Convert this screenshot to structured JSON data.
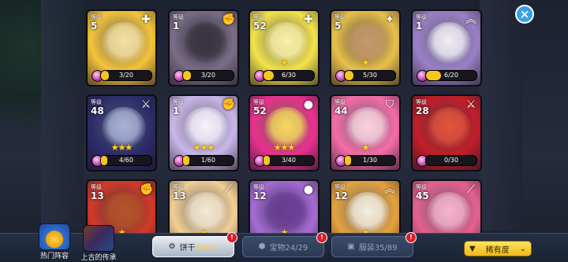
{
  "close_label": "×",
  "level_label": "等级",
  "cookies": [
    {
      "level": "5",
      "type_icon": "plus-icon",
      "type_glyph": "✚",
      "stars": 0,
      "progress": "3/20",
      "fill": 0.15,
      "bg": "#f4c33a",
      "portrait": "#f7e2a4"
    },
    {
      "level": "1",
      "type_icon": "fist-icon",
      "type_glyph": "✊",
      "stars": 0,
      "progress": "3/20",
      "fill": 0.15,
      "bg": "#7a6e86",
      "portrait": "#3a3540"
    },
    {
      "level": "52",
      "type_icon": "plus-icon",
      "type_glyph": "✚",
      "stars": 1,
      "progress": "6/30",
      "fill": 0.2,
      "bg": "#f3e24a",
      "portrait": "#fff2a8"
    },
    {
      "level": "5",
      "type_icon": "sparkle-icon",
      "type_glyph": "✦",
      "stars": 1,
      "progress": "5/30",
      "fill": 0.17,
      "bg": "#e8c04a",
      "portrait": "#c69a6a"
    },
    {
      "level": "1",
      "type_icon": "chevron-up-icon",
      "type_glyph": "︽",
      "stars": 0,
      "progress": "6/20",
      "fill": 0.3,
      "bg": "#9a7fc6",
      "portrait": "#f1eef6"
    },
    {
      "level": "48",
      "type_icon": "sword-icon",
      "type_glyph": "⚔",
      "stars": 3,
      "progress": "4/60",
      "fill": 0.07,
      "bg": "#2c2b6a",
      "portrait": "#a9b2d6"
    },
    {
      "level": "1",
      "type_icon": "fist-icon",
      "type_glyph": "✊",
      "stars": 3,
      "progress": "1/60",
      "fill": 0.02,
      "bg": "#c9b6e9",
      "portrait": "#f7f3ff"
    },
    {
      "level": "52",
      "type_icon": "bomb-icon",
      "type_glyph": "●",
      "stars": 3,
      "progress": "3/40",
      "fill": 0.08,
      "bg": "#e9318f",
      "portrait": "#f6d860"
    },
    {
      "level": "44",
      "type_icon": "shield-icon",
      "type_glyph": "⛉",
      "stars": 1,
      "progress": "1/30",
      "fill": 0.03,
      "bg": "#f46ca6",
      "portrait": "#fbd3df"
    },
    {
      "level": "28",
      "type_icon": "sword-icon",
      "type_glyph": "⚔",
      "stars": 0,
      "progress": "0/30",
      "fill": 0.0,
      "bg": "#c11e2a",
      "portrait": "#e4533c"
    },
    {
      "level": "13",
      "type_icon": "fist-icon",
      "type_glyph": "✊",
      "stars": 1,
      "progress": "",
      "fill": 0.0,
      "bg": "#d23a2a",
      "portrait": "#b7532b"
    },
    {
      "level": "13",
      "type_icon": "wand-icon",
      "type_glyph": "⟋",
      "stars": 1,
      "progress": "",
      "fill": 0.0,
      "bg": "#f2cf93",
      "portrait": "#f7ead2"
    },
    {
      "level": "12",
      "type_icon": "bomb-icon",
      "type_glyph": "●",
      "stars": 1,
      "progress": "",
      "fill": 0.0,
      "bg": "#a66bd4",
      "portrait": "#6b3f96"
    },
    {
      "level": "12",
      "type_icon": "chevron-up-icon",
      "type_glyph": "︽",
      "stars": 1,
      "progress": "",
      "fill": 0.0,
      "bg": "#e5a23c",
      "portrait": "#f7efe0"
    },
    {
      "level": "45",
      "type_icon": "wand-icon",
      "type_glyph": "⟋",
      "stars": 0,
      "progress": "",
      "fill": 0.0,
      "bg": "#e4618e",
      "portrait": "#f7b5cf"
    }
  ],
  "left_buttons": {
    "hot_team": "热门阵容",
    "ancient": "上古的传承"
  },
  "tabs": {
    "cookie_label": "饼干",
    "cookie_count": "54/87",
    "treasure_label": "宝物",
    "treasure_count": "24/29",
    "costume_label": "服装",
    "costume_count": "35/89",
    "badge": "!"
  },
  "sort": {
    "label": "稀有度",
    "filter_icon": "▼",
    "arrow": "⌄"
  }
}
